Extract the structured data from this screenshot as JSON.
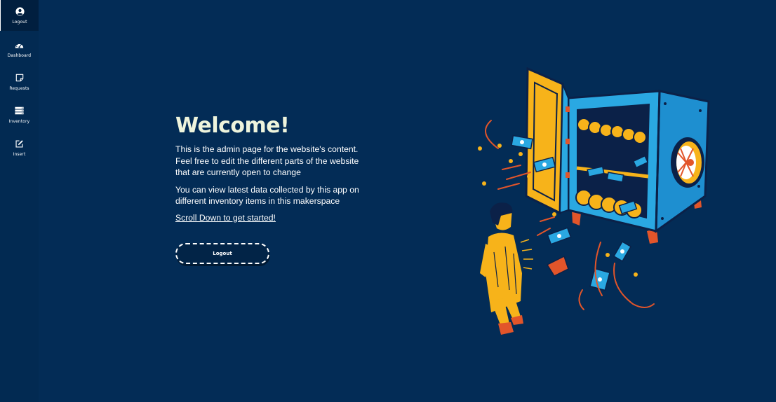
{
  "sidebar": {
    "items": [
      {
        "label": "Logout",
        "icon": "user-circle-icon",
        "active": true
      },
      {
        "label": "Dashboard",
        "icon": "gauge-icon",
        "active": false
      },
      {
        "label": "Requests",
        "icon": "sticky-note-icon",
        "active": false
      },
      {
        "label": "Inventory",
        "icon": "server-icon",
        "active": false
      },
      {
        "label": "Insert",
        "icon": "edit-icon",
        "active": false
      }
    ]
  },
  "hero": {
    "title": "Welcome!",
    "paragraph1": "This is the admin page for the website's content. Feel free to edit the different parts of the website that are currently open to change",
    "paragraph2": "You can view latest data collected by this app on different inventory items in this makerspace",
    "scroll_link": "Scroll Down to get started!",
    "logout_button": "Logout"
  },
  "colors": {
    "background": "#032c56",
    "sidebar": "#022a52",
    "title": "#eef4dc",
    "safe_blue": "#29a6e0",
    "gold": "#f7b31a",
    "accent_red": "#e2552a"
  }
}
